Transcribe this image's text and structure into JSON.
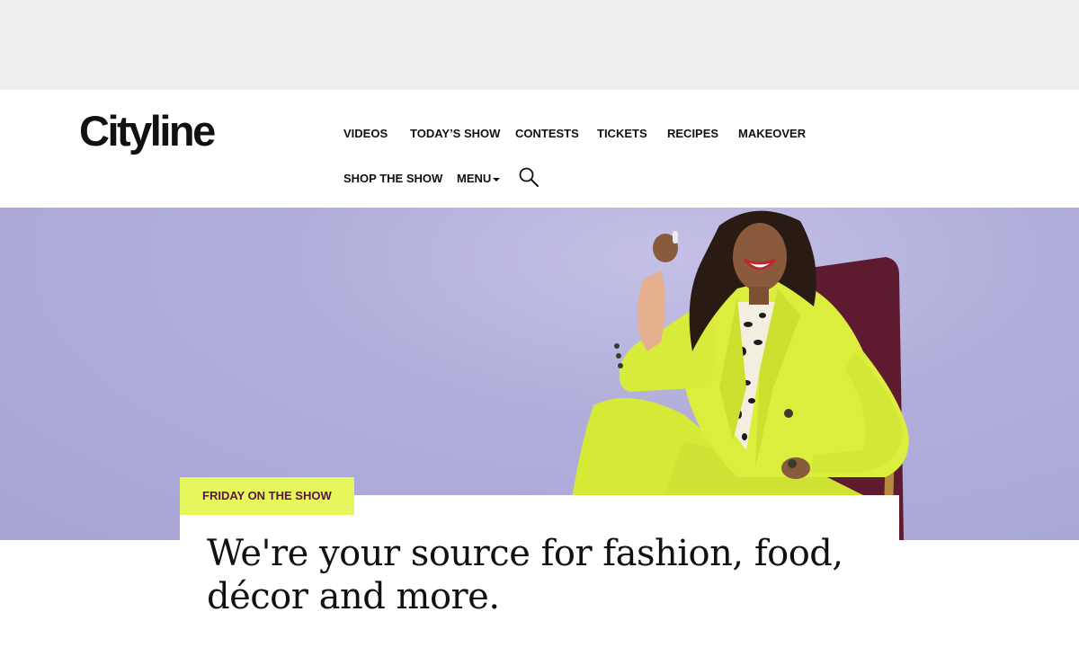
{
  "brand": {
    "logo_text": "Cityline"
  },
  "nav": {
    "items": [
      {
        "label": "VIDEOS"
      },
      {
        "label": "TODAY’S SHOW"
      },
      {
        "label": "CONTESTS"
      },
      {
        "label": "TICKETS"
      },
      {
        "label": "RECIPES"
      },
      {
        "label": "MAKEOVER"
      },
      {
        "label": "SHOP THE SHOW"
      },
      {
        "label": "MENU"
      }
    ],
    "search_icon": "search-icon"
  },
  "hero": {
    "tag": "FRIDAY ON THE SHOW",
    "headline": "We're your source for fashion, food, décor and more."
  },
  "colors": {
    "hero_background": "#a9a6d6",
    "tag_background": "#e6f75e",
    "tag_text": "#5a1248",
    "suit": "#d9ec3a",
    "chair": "#5e1a2e"
  }
}
